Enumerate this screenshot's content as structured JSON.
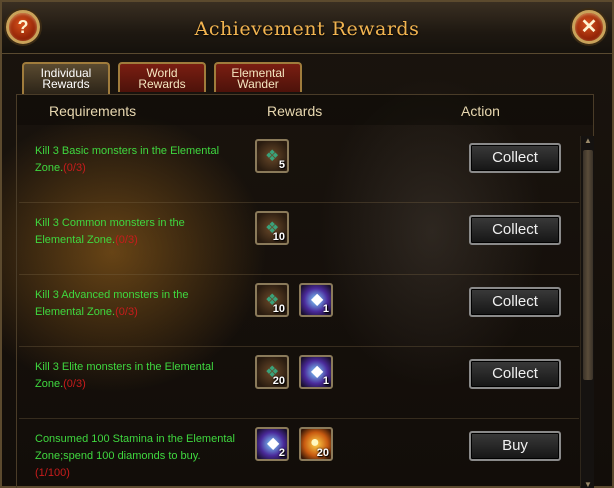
{
  "window": {
    "title": "Achievement Rewards",
    "help_label": "?",
    "close_label": "✕"
  },
  "tabs": [
    {
      "label": "Individual Rewards",
      "active": true
    },
    {
      "label": "World Rewards",
      "active": false
    },
    {
      "label": "Elemental Wander",
      "active": false
    }
  ],
  "headers": {
    "requirements": "Requirements",
    "rewards": "Rewards",
    "action": "Action"
  },
  "rows": [
    {
      "req": "Kill 3 Basic monsters in the Elemental Zone.",
      "progress": "(0/3)",
      "rewards": [
        {
          "icon": "scroll-icon",
          "qty": "5"
        }
      ],
      "action": "Collect"
    },
    {
      "req": "Kill 3 Common monsters in the Elemental Zone.",
      "progress": "(0/3)",
      "rewards": [
        {
          "icon": "scroll-icon",
          "qty": "10"
        }
      ],
      "action": "Collect"
    },
    {
      "req": "Kill 3 Advanced monsters in the Elemental Zone.",
      "progress": "(0/3)",
      "rewards": [
        {
          "icon": "scroll-icon",
          "qty": "10"
        },
        {
          "icon": "crystal-icon",
          "qty": "1"
        }
      ],
      "action": "Collect"
    },
    {
      "req": "Kill 3 Elite monsters in the Elemental Zone.",
      "progress": "(0/3)",
      "rewards": [
        {
          "icon": "scroll-icon",
          "qty": "20"
        },
        {
          "icon": "crystal-icon",
          "qty": "1"
        }
      ],
      "action": "Collect"
    },
    {
      "req": "Consumed 100 Stamina in the Elemental Zone;spend 100 diamonds to buy.",
      "progress": "(1/100)",
      "rewards": [
        {
          "icon": "crystal-icon",
          "qty": "2"
        },
        {
          "icon": "orb-icon",
          "qty": "20"
        }
      ],
      "action": "Buy"
    }
  ],
  "scrollbar": {
    "up": "▲",
    "down": "▼"
  },
  "colors": {
    "title": "#f2b450",
    "requirement_text": "#3fd83f",
    "progress_text": "#c81c1c"
  }
}
